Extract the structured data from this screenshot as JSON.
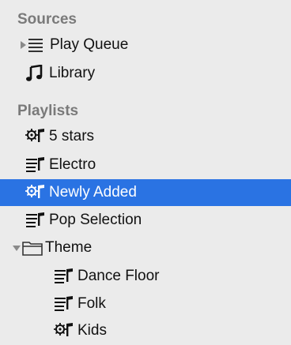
{
  "sources": {
    "header": "Sources",
    "items": [
      {
        "label": "Play Queue",
        "icon": "play-queue-icon"
      },
      {
        "label": "Library",
        "icon": "music-note-icon"
      }
    ]
  },
  "playlists": {
    "header": "Playlists",
    "items": [
      {
        "label": "5 stars",
        "icon": "smart-playlist-icon"
      },
      {
        "label": "Electro",
        "icon": "playlist-icon"
      },
      {
        "label": "Newly Added",
        "icon": "smart-playlist-icon",
        "selected": true
      },
      {
        "label": "Pop Selection",
        "icon": "playlist-icon"
      },
      {
        "label": "Theme",
        "icon": "folder-icon",
        "expanded": true,
        "children": [
          {
            "label": "Dance Floor",
            "icon": "playlist-icon"
          },
          {
            "label": "Folk",
            "icon": "playlist-icon"
          },
          {
            "label": "Kids",
            "icon": "smart-playlist-icon"
          }
        ]
      }
    ]
  },
  "colors": {
    "background": "#ebebeb",
    "selection": "#2a73e3",
    "header_text": "#7a7a7a"
  }
}
